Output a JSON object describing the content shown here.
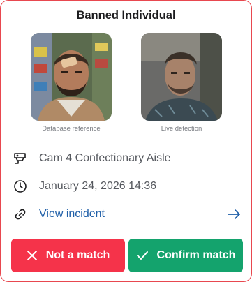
{
  "card": {
    "title": "Banned Individual",
    "accent_color": "#e8484f"
  },
  "photos": {
    "reference": {
      "caption": "Database reference",
      "icon": "person-photo"
    },
    "live": {
      "caption": "Live detection",
      "icon": "person-photo"
    }
  },
  "details": {
    "camera": {
      "icon": "cctv-camera-icon",
      "text": "Cam 4 Confectionary Aisle"
    },
    "time": {
      "icon": "clock-icon",
      "text": "January 24, 2026 14:36"
    },
    "incident": {
      "icon": "link-icon",
      "text": "View incident",
      "trailing_icon": "arrow-right-icon",
      "color": "#1f5fa8"
    }
  },
  "actions": {
    "reject": {
      "label": "Not a match",
      "icon": "x-icon",
      "color": "#f5334a"
    },
    "confirm": {
      "label": "Confirm match",
      "icon": "check-icon",
      "color": "#14a36d"
    }
  }
}
